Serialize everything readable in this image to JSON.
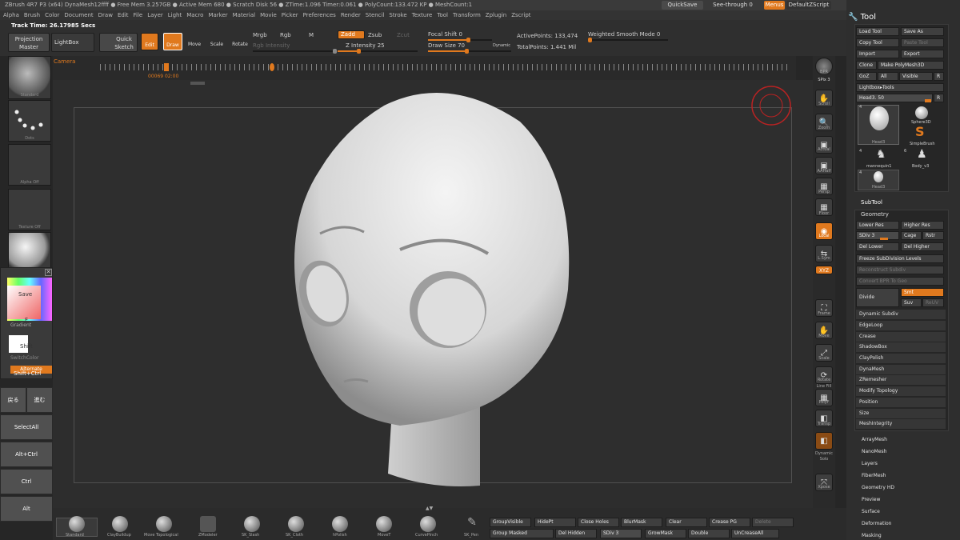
{
  "titlebar": "ZBrush 4R7 P3 (x64)   DynaMesh12ffff   ● Free Mem 3.257GB ● Active Mem 680 ● Scratch Disk 56 ● ZTime:1.096 Timer:0.061 ● PolyCount:133.472 KP ● MeshCount:1",
  "menus": [
    "Alpha",
    "Brush",
    "Color",
    "Document",
    "Draw",
    "Edit",
    "File",
    "Layer",
    "Light",
    "Macro",
    "Marker",
    "Material",
    "Movie",
    "Picker",
    "Preferences",
    "Render",
    "Stencil",
    "Stroke",
    "Texture",
    "Tool",
    "Transform",
    "Zplugin",
    "Zscript"
  ],
  "top_right": {
    "quicksave": "QuickSave",
    "see_through": "See-through  0",
    "menus": "Menus",
    "script": "DefaultZScript"
  },
  "tool_title": "Tool",
  "track_time": "Track Time: 26.17985 Secs",
  "shelf": {
    "projection_master": "Projection Master",
    "lightbox": "LightBox",
    "quick_sketch": "Quick Sketch",
    "edit": "Edit",
    "draw": "Draw",
    "move": "Move",
    "scale": "Scale",
    "rotate": "Rotate",
    "mrgb": "Mrgb",
    "rgb": "Rgb",
    "m": "M",
    "zadd": "Zadd",
    "zsub": "Zsub",
    "zcut": "Zcut",
    "rgb_intensity": "Rgb Intensity",
    "z_intensity": "Z Intensity 25",
    "focal_shift": "Focal Shift 0",
    "draw_size": "Draw Size 70",
    "dynamic": "Dynamic",
    "active_points": "ActivePoints: 133,474",
    "total_points": "TotalPoints: 1.441 Mil",
    "weighted_smooth": "Weighted Smooth Mode 0"
  },
  "timeline": {
    "label": "Camera",
    "time": "00069 02:00"
  },
  "left": {
    "thumbs": [
      "Standard",
      "Dots",
      "Alpha Off",
      "Texture Off",
      ""
    ],
    "color_popup": {
      "save": "Save",
      "gradient": "Gradient",
      "f": "F",
      "shift": "Shift",
      "switch": "SwitchColor",
      "alternate": "Alternate",
      "shiftctrl": "Shift+Ctrl"
    },
    "keys": [
      "戻る",
      "進む",
      "SelectAll",
      "Alt+Ctrl",
      "Ctrl",
      "Alt"
    ]
  },
  "rcol": [
    "BPR",
    "SPix 3",
    "Scroll",
    "Zoom",
    "Actual",
    "AAHalf",
    "Persp",
    "Floor",
    "Local",
    "L.Sym",
    "XYZ",
    "Frame",
    "Move",
    "Scale",
    "Rotate",
    "Line Fill",
    "PolyF",
    "Transp",
    "Dynamic",
    "Solo",
    "Xpose"
  ],
  "tool": {
    "load": "Load Tool",
    "save_as": "Save As",
    "copy": "Copy Tool",
    "paste": "Paste Tool",
    "import": "Import",
    "export": "Export",
    "clone": "Clone",
    "make_poly": "Make PolyMesh3D",
    "goz": "GoZ",
    "all": "All",
    "visible": "Visible",
    "r": "R",
    "lightbox_tools": "Lightbox▸Tools",
    "head_slider": "Head3. 50",
    "items": [
      {
        "count": "4",
        "name": "Head3"
      },
      {
        "count": "",
        "name": "Sphere3D"
      },
      {
        "count": "",
        "name": "SimpleBrush"
      },
      {
        "count": "4",
        "name": "mannequin1"
      },
      {
        "count": "6",
        "name": "Body_v3"
      },
      {
        "count": "4",
        "name": "Head3"
      }
    ],
    "subtool": "SubTool",
    "geometry": "Geometry",
    "lower_res": "Lower Res",
    "higher_res": "Higher Res",
    "sdiv": "SDiv 3",
    "cage": "Cage",
    "rstr": "Rstr",
    "del_lower": "Del Lower",
    "del_higher": "Del Higher",
    "freeze": "Freeze SubDivision Levels",
    "reconstruct": "Reconstruct Subdiv",
    "convert_bpr": "Convert BPR To Geo",
    "divide": "Divide",
    "smt": "Smt",
    "suv": "Suv",
    "reuv": "ReUV",
    "geo_rows": [
      "Dynamic Subdiv",
      "EdgeLoop",
      "Crease",
      "ShadowBox",
      "ClayPolish",
      "DynaMesh",
      "ZRemesher",
      "Modify Topology",
      "Position",
      "Size",
      "MeshIntegrity"
    ],
    "sub_rows": [
      "ArrayMesh",
      "NanoMesh",
      "Layers",
      "FiberMesh",
      "Geometry HD",
      "Preview",
      "Surface",
      "Deformation",
      "Masking"
    ]
  },
  "bottom": {
    "brushes": [
      "Standard",
      "ClayBuildup",
      "Move Topological",
      "ZModeler",
      "SK_Slash",
      "SK_Cloth",
      "hPolish",
      "MoveT",
      "CurvePinch",
      "SK_Pen"
    ],
    "buttons": [
      "GroupVisible",
      "HidePt",
      "Close Holes",
      "BlurMask",
      "Clear",
      "Crease PG",
      "Delete",
      "Group Masked",
      "Del Hidden",
      "SDiv 3",
      "GrowMask",
      "Double",
      "UnCreaseAll"
    ]
  }
}
